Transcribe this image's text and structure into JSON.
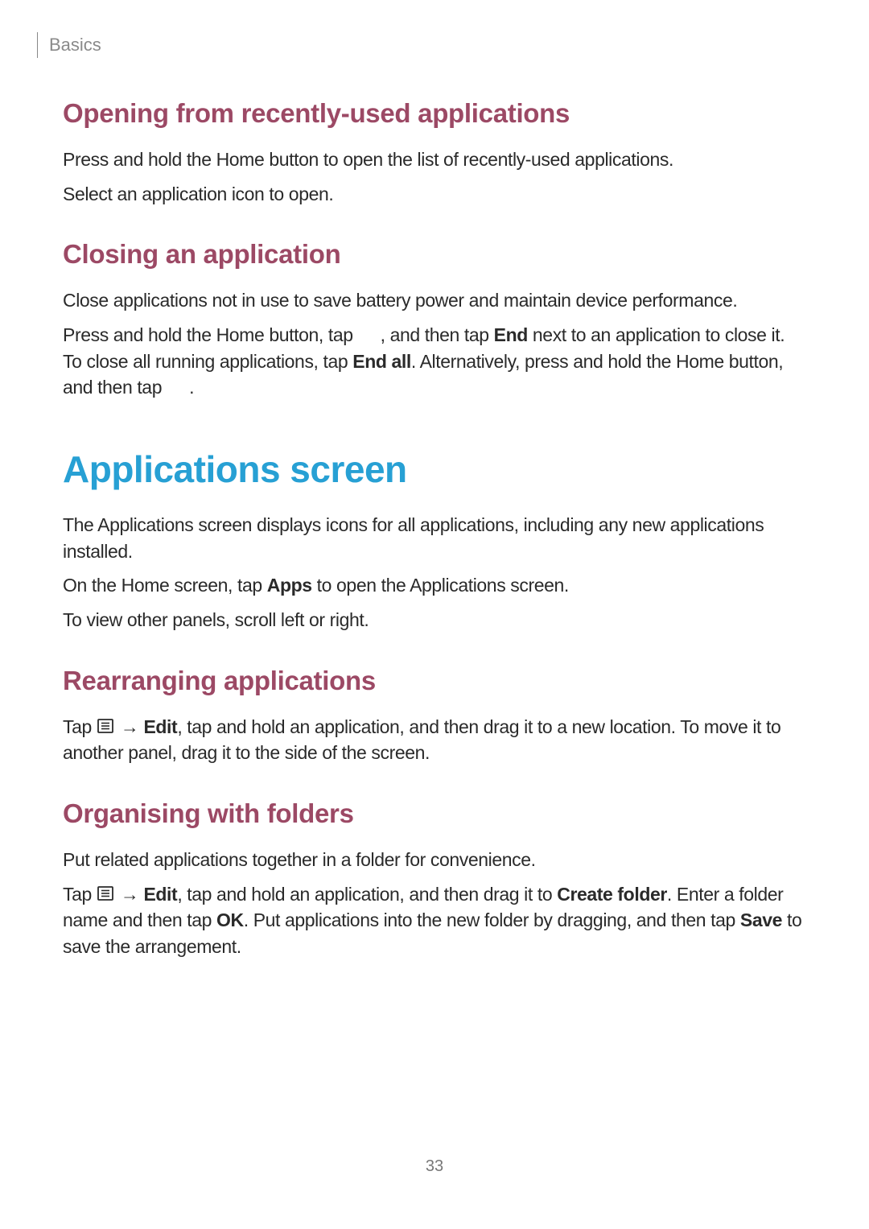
{
  "breadcrumb": "Basics",
  "section1": {
    "heading": "Opening from recently-used applications",
    "p1": "Press and hold the Home button to open the list of recently-used applications.",
    "p2": "Select an application icon to open."
  },
  "section2": {
    "heading": "Closing an application",
    "p1": "Close applications not in use to save battery power and maintain device performance.",
    "p2a": "Press and hold the Home button, tap ",
    "p2b": " , and then tap ",
    "p2_bold1": "End",
    "p2c": " next to an application to close it. To close all running applications, tap ",
    "p2_bold2": "End all",
    "p2d": ". Alternatively, press and hold the Home button, and then tap ",
    "p2e": " ."
  },
  "section3": {
    "title": "Applications screen",
    "p1": "The Applications screen displays icons for all applications, including any new applications installed.",
    "p2a": "On the Home screen, tap ",
    "p2_bold1": "Apps",
    "p2b": " to open the Applications screen.",
    "p3": "To view other panels, scroll left or right."
  },
  "section4": {
    "heading": "Rearranging applications",
    "p1a": "Tap ",
    "arrow": " → ",
    "p1_bold1": "Edit",
    "p1b": ", tap and hold an application, and then drag it to a new location. To move it to another panel, drag it to the side of the screen."
  },
  "section5": {
    "heading": "Organising with folders",
    "p1": "Put related applications together in a folder for convenience.",
    "p2a": "Tap ",
    "arrow": " → ",
    "p2_bold1": "Edit",
    "p2b": ", tap and hold an application, and then drag it to ",
    "p2_bold2": "Create folder",
    "p2c": ". Enter a folder name and then tap ",
    "p2_bold3": "OK",
    "p2d": ". Put applications into the new folder by dragging, and then tap ",
    "p2_bold4": "Save",
    "p2e": " to save the arrangement."
  },
  "page_number": "33"
}
